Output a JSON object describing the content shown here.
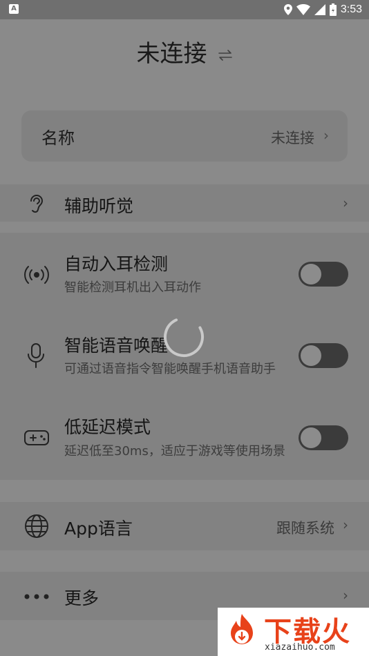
{
  "status_bar": {
    "time": "3:53",
    "app_icon_letter": "A"
  },
  "header": {
    "title": "未连接"
  },
  "name_card": {
    "label": "名称",
    "value": "未连接"
  },
  "rows": {
    "hearing_aid": {
      "label": "辅助听觉"
    },
    "in_ear": {
      "label": "自动入耳检测",
      "subtitle": "智能检测耳机出入耳动作",
      "enabled": false
    },
    "voice_wake": {
      "label": "智能语音唤醒",
      "subtitle": "可通过语音指令智能唤醒手机语音助手",
      "enabled": false
    },
    "low_latency": {
      "label": "低延迟模式",
      "subtitle": "延迟低至30ms，适应于游戏等使用场景",
      "enabled": false
    },
    "app_language": {
      "label": "App语言",
      "value": "跟随系统"
    },
    "more": {
      "label": "更多"
    }
  },
  "watermark": {
    "brand": "下载火",
    "domain": "xiazaihuo.com"
  },
  "colors": {
    "overlay_bg": "#8a8a8a",
    "watermark_accent": "#e8421a"
  }
}
